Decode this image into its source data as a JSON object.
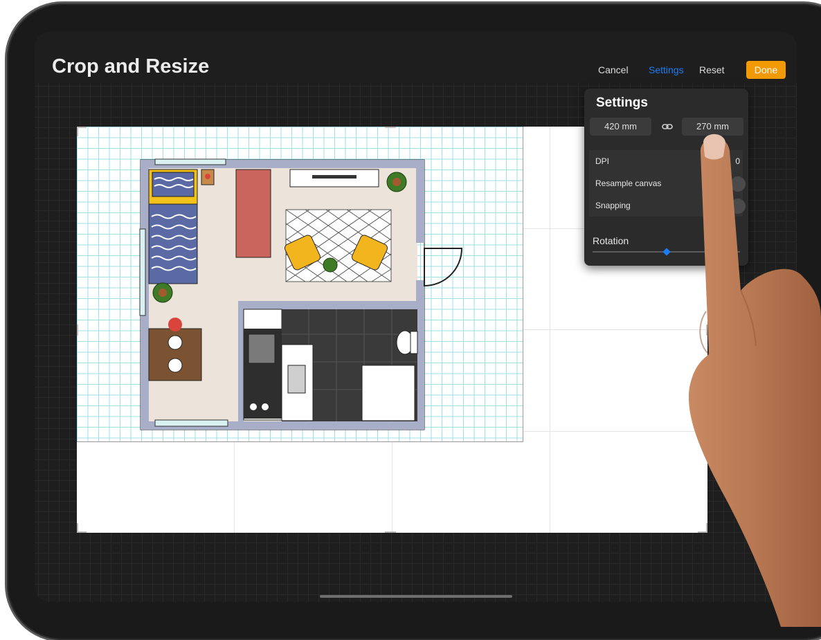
{
  "header": {
    "title": "Crop and Resize",
    "cancel_label": "Cancel",
    "settings_label": "Settings",
    "reset_label": "Reset",
    "done_label": "Done"
  },
  "settings_panel": {
    "title": "Settings",
    "width_value": "420 mm",
    "height_value": "270 mm",
    "link_icon": "link-icon",
    "rows": [
      {
        "label": "DPI",
        "value": "0"
      },
      {
        "label": "Resample canvas"
      },
      {
        "label": "Snapping"
      }
    ],
    "rotation_label": "Rotation",
    "rotation_slider_fraction": 0.5
  },
  "colors": {
    "accent": "#1e7cf2",
    "done_button": "#f19a05",
    "grid_line": "#9fe0e0"
  }
}
